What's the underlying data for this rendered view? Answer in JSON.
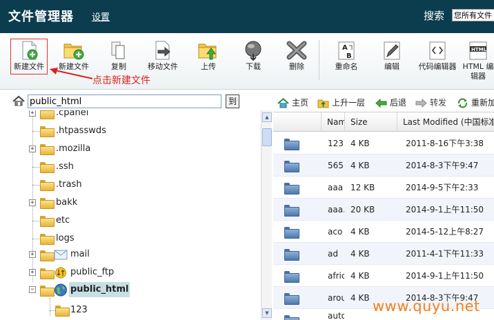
{
  "header": {
    "title": "文件管理器",
    "settings_link": "设置",
    "search_label": "搜索",
    "search_scope": "您所有文件"
  },
  "toolbar": {
    "buttons": [
      {
        "label": "新建文件",
        "icon": "new-file-icon"
      },
      {
        "label": "新建文件夹",
        "icon": "new-folder-icon"
      },
      {
        "label": "复制",
        "icon": "copy-icon"
      },
      {
        "label": "移动文件",
        "icon": "move-file-icon"
      },
      {
        "label": "上传",
        "icon": "upload-icon"
      },
      {
        "label": "下载",
        "icon": "download-icon"
      },
      {
        "label": "删除",
        "icon": "delete-icon"
      },
      {
        "label": "重命名",
        "icon": "rename-icon"
      },
      {
        "label": "编辑",
        "icon": "edit-icon"
      },
      {
        "label": "代码编辑器",
        "icon": "code-editor-icon"
      },
      {
        "label": "HTML 编辑器",
        "icon": "html-editor-icon"
      }
    ],
    "annotation": "点击新建文件"
  },
  "pathbar": {
    "path": "public_html",
    "go_label": "到"
  },
  "tree": {
    "items": [
      {
        "label": ".cpanel",
        "expandable": true
      },
      {
        "label": ".htpasswds",
        "expandable": false
      },
      {
        "label": ".mozilla",
        "expandable": true
      },
      {
        "label": ".ssh",
        "expandable": false
      },
      {
        "label": ".trash",
        "expandable": false
      },
      {
        "label": "bakk",
        "expandable": true
      },
      {
        "label": "etc",
        "expandable": false
      },
      {
        "label": "logs",
        "expandable": false
      },
      {
        "label": "mail",
        "expandable": true,
        "icon": "mail-folder-icon"
      },
      {
        "label": "public_ftp",
        "expandable": true,
        "icon": "ftp-folder-icon"
      },
      {
        "label": "public_html",
        "expandable": true,
        "expanded": true,
        "selected": true,
        "icon": "web-folder-icon"
      },
      {
        "label": "123",
        "expandable": false,
        "child": true
      }
    ]
  },
  "nav": {
    "home": "主页",
    "up": "上升一层",
    "back": "后退",
    "forward": "转发",
    "reload": "重新加"
  },
  "table": {
    "columns": [
      "Nam",
      "Size",
      "Last Modified (中国标准"
    ],
    "rows": [
      {
        "name": "123",
        "size": "4 KB",
        "modified": "2011-8-16下午3:38"
      },
      {
        "name": "565",
        "size": "4 KB",
        "modified": "2014-8-3下午9:47"
      },
      {
        "name": "aaa",
        "size": "12 KB",
        "modified": "2014-9-5下午2:33"
      },
      {
        "name": "aaa.",
        "size": "20 KB",
        "modified": "2014-9-1上午11:50"
      },
      {
        "name": "aco",
        "size": "4 KB",
        "modified": "2014-5-12上午8:27"
      },
      {
        "name": "ad",
        "size": "4 KB",
        "modified": "2011-4-1下午11:33"
      },
      {
        "name": "afric",
        "size": "4 KB",
        "modified": "2014-9-1上午11:50"
      },
      {
        "name": "arou",
        "size": "4 KB",
        "modified": "2014-8-3下午9:47"
      },
      {
        "name": "auto",
        "size": "",
        "modified": ""
      }
    ]
  },
  "watermark": "www.quyu.net",
  "colors": {
    "header_bg": "#0c3d4f",
    "annotation_red": "#d8231e",
    "watermark_orange": "#f0821e",
    "selected_bg": "#c7dfe3"
  }
}
